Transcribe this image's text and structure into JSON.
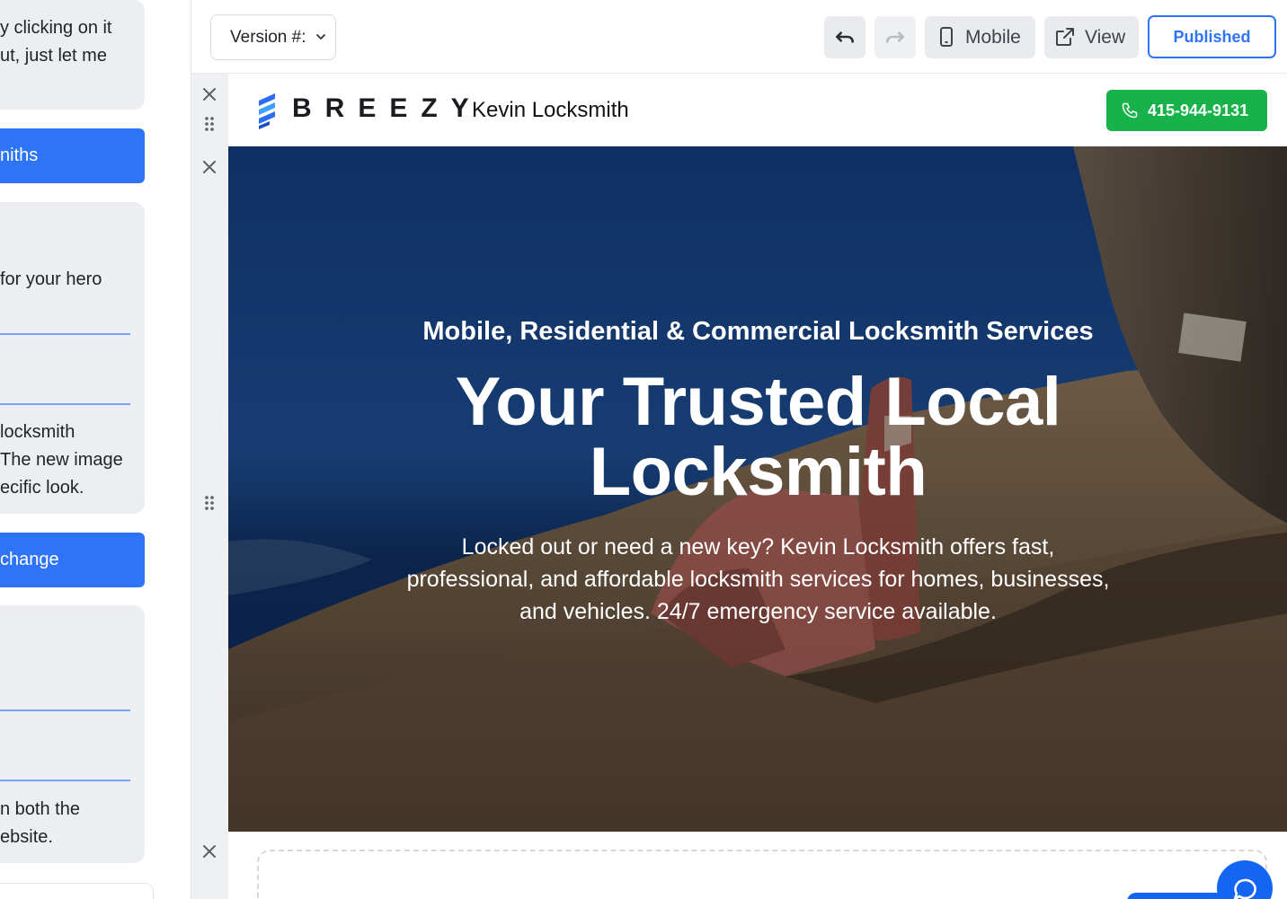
{
  "chat": {
    "bubble1_lines": [
      "y clicking on it",
      "ut, just let me"
    ],
    "btn1_label": "niths",
    "bubble2_lines": [
      "for your hero",
      "locksmith",
      "The new image",
      "ecific look."
    ],
    "btn2_label": "change",
    "bubble3_lines": [
      "n both the",
      "ebsite."
    ]
  },
  "toolbar": {
    "version_label": "Version #:",
    "mobile_label": "Mobile",
    "view_label": "View",
    "published_label": "Published"
  },
  "site": {
    "logo_word": "BREEZY",
    "brand_name": "Kevin Locksmith",
    "phone": "415-944-9131",
    "hero": {
      "subtitle": "Mobile, Residential & Commercial Locksmith Services",
      "title_line1": "Your Trusted Local",
      "title_line2": "Locksmith",
      "desc_line1": "Locked out or need a new key? Kevin Locksmith offers fast,",
      "desc_line2": "professional, and affordable locksmith services for homes, businesses,",
      "desc_line3": "and vehicles. 24/7 emergency service available."
    }
  },
  "colors": {
    "accent_blue": "#2f74f6",
    "phone_green": "#17b34a",
    "chat_fab": "#1466f2"
  },
  "icons": [
    "undo-icon",
    "redo-icon",
    "mobile-phone-icon",
    "external-link-icon",
    "phone-icon",
    "close-icon",
    "drag-handle-icon",
    "chat-bubble-icon",
    "chevron-down-icon"
  ]
}
